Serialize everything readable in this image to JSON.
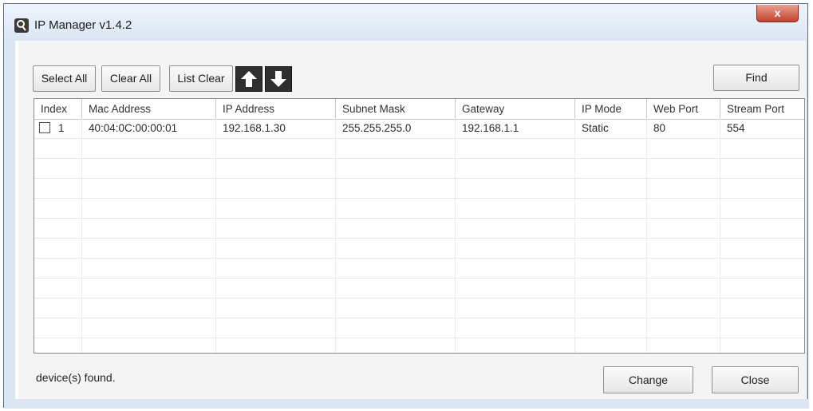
{
  "window": {
    "title": "IP Manager v1.4.2",
    "close_glyph": "x",
    "accent": "#c4412d"
  },
  "toolbar": {
    "select_all": "Select All",
    "clear_all": "Clear All",
    "list_clear": "List Clear",
    "up_icon": "arrow-up-icon",
    "down_icon": "arrow-down-icon",
    "find": "Find"
  },
  "table": {
    "columns": [
      "Index",
      "Mac Address",
      "IP Address",
      "Subnet Mask",
      "Gateway",
      "IP Mode",
      "Web Port",
      "Stream Port"
    ],
    "rows": [
      {
        "checked": false,
        "index": "1",
        "mac": "40:04:0C:00:00:01",
        "ip": "192.168.1.30",
        "subnet": "255.255.255.0",
        "gateway": "192.168.1.1",
        "ip_mode": "Static",
        "web_port": "80",
        "stream_port": "554"
      }
    ]
  },
  "status": {
    "text": "device(s) found."
  },
  "footer": {
    "change": "Change",
    "close": "Close"
  }
}
